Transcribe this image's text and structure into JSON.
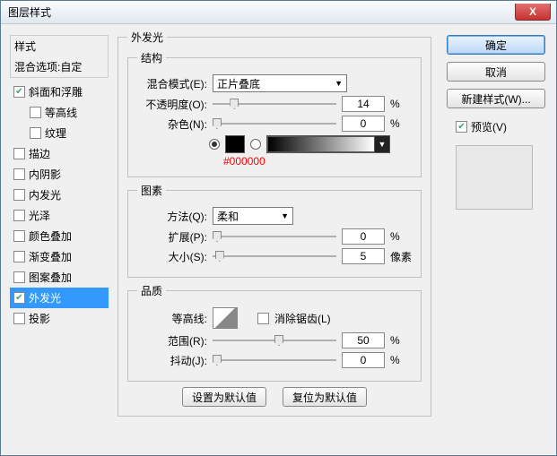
{
  "window": {
    "title": "图层样式"
  },
  "close": "X",
  "left": {
    "header": "样式",
    "sub": "混合选项:自定",
    "items": [
      {
        "label": "斜面和浮雕",
        "checked": true,
        "indent": false
      },
      {
        "label": "等高线",
        "checked": false,
        "indent": true
      },
      {
        "label": "纹理",
        "checked": false,
        "indent": true
      },
      {
        "label": "描边",
        "checked": false,
        "indent": false
      },
      {
        "label": "内阴影",
        "checked": false,
        "indent": false
      },
      {
        "label": "内发光",
        "checked": false,
        "indent": false
      },
      {
        "label": "光泽",
        "checked": false,
        "indent": false
      },
      {
        "label": "颜色叠加",
        "checked": false,
        "indent": false
      },
      {
        "label": "渐变叠加",
        "checked": false,
        "indent": false
      },
      {
        "label": "图案叠加",
        "checked": false,
        "indent": false
      },
      {
        "label": "外发光",
        "checked": true,
        "indent": false,
        "selected": true
      },
      {
        "label": "投影",
        "checked": false,
        "indent": false
      }
    ]
  },
  "panel": {
    "title": "外发光",
    "struct": {
      "legend": "结构",
      "blend_label": "混合模式(E):",
      "blend_value": "正片叠底",
      "opacity_label": "不透明度(O):",
      "opacity_value": "14",
      "opacity_unit": "%",
      "noise_label": "杂色(N):",
      "noise_value": "0",
      "noise_unit": "%",
      "color_code": "#000000"
    },
    "elem": {
      "legend": "图素",
      "method_label": "方法(Q):",
      "method_value": "柔和",
      "spread_label": "扩展(P):",
      "spread_value": "0",
      "spread_unit": "%",
      "size_label": "大小(S):",
      "size_value": "5",
      "size_unit": "像素"
    },
    "qual": {
      "legend": "品质",
      "contour_label": "等高线:",
      "anti_label": "消除锯齿(L)",
      "range_label": "范围(R):",
      "range_value": "50",
      "range_unit": "%",
      "jitter_label": "抖动(J):",
      "jitter_value": "0",
      "jitter_unit": "%"
    },
    "defaults": {
      "set": "设置为默认值",
      "reset": "复位为默认值"
    }
  },
  "right": {
    "ok": "确定",
    "cancel": "取消",
    "newstyle": "新建样式(W)...",
    "preview_label": "预览(V)"
  }
}
